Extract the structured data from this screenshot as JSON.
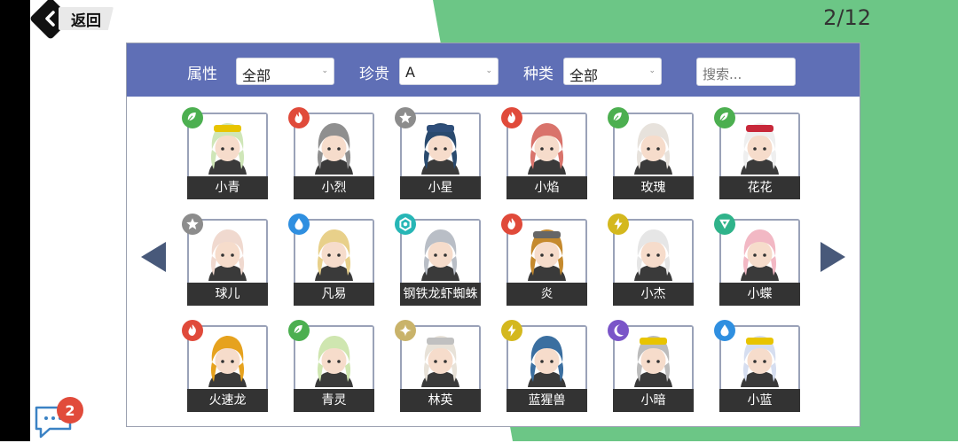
{
  "header": {
    "back_label": "返回",
    "page_indicator": "2/12"
  },
  "filters": {
    "attribute": {
      "label": "属性",
      "value": "全部"
    },
    "rarity": {
      "label": "珍贵",
      "value": "A"
    },
    "kind": {
      "label": "种类",
      "value": "全部"
    },
    "search": {
      "placeholder": "搜索..."
    }
  },
  "element_colors": {
    "grass": "#4caf50",
    "fire": "#e04a3a",
    "star": "#8c8c8c",
    "water": "#2f8fe0",
    "electric": "#d4b81e",
    "spark": "#c9b36a",
    "dark": "#7a55c8",
    "cyan": "#27b6b6",
    "teal": "#2fb38a"
  },
  "characters": [
    {
      "name": "小青",
      "element": "grass",
      "icon": "leaf-icon",
      "hair": "#cfe6b8",
      "hat": "#e8c400"
    },
    {
      "name": "小烈",
      "element": "fire",
      "icon": "flame-icon",
      "hair": "#8f8f8f",
      "hat": ""
    },
    {
      "name": "小星",
      "element": "star",
      "icon": "star-icon",
      "hair": "#2a4a6e",
      "hat": "#2f4f7a"
    },
    {
      "name": "小焰",
      "element": "fire",
      "icon": "flame-icon",
      "hair": "#d9736b",
      "hat": ""
    },
    {
      "name": "玫瑰",
      "element": "grass",
      "icon": "leaf-icon",
      "hair": "#e7e2dc",
      "hat": ""
    },
    {
      "name": "花花",
      "element": "grass",
      "icon": "leaf-icon",
      "hair": "#efefef",
      "hat": "#c8283a"
    },
    {
      "name": "球儿",
      "element": "star",
      "icon": "star-icon",
      "hair": "#f0d9cf",
      "hat": ""
    },
    {
      "name": "凡易",
      "element": "water",
      "icon": "water-drop-icon",
      "hair": "#e8d08a",
      "hat": ""
    },
    {
      "name": "钢铁龙虾蜘蛛",
      "element": "cyan",
      "icon": "hexagon-icon",
      "hair": "#b9bec6",
      "hat": ""
    },
    {
      "name": "炎",
      "element": "fire",
      "icon": "flame-icon",
      "hair": "#c58a2e",
      "hat": "#666666"
    },
    {
      "name": "小杰",
      "element": "electric",
      "icon": "lightning-icon",
      "hair": "#e6e6e6",
      "hat": ""
    },
    {
      "name": "小蝶",
      "element": "teal",
      "icon": "triangle-icon",
      "hair": "#f2b8c4",
      "hat": ""
    },
    {
      "name": "火速龙",
      "element": "fire",
      "icon": "flame-icon",
      "hair": "#e6a21e",
      "hat": ""
    },
    {
      "name": "青灵",
      "element": "grass",
      "icon": "leaf-icon",
      "hair": "#cfe6b0",
      "hat": ""
    },
    {
      "name": "林英",
      "element": "spark",
      "icon": "sparkle-icon",
      "hair": "#e8e2d8",
      "hat": "#c0c0c0"
    },
    {
      "name": "蓝猩兽",
      "element": "electric",
      "icon": "lightning-icon",
      "hair": "#3b6fa0",
      "hat": ""
    },
    {
      "name": "小暗",
      "element": "dark",
      "icon": "crescent-moon-icon",
      "hair": "#bcbcbc",
      "hat": "#e8c400"
    },
    {
      "name": "小蓝",
      "element": "water",
      "icon": "water-drop-icon",
      "hair": "#d6def0",
      "hat": "#e8c400"
    }
  ],
  "chat": {
    "unread_count": "2"
  }
}
